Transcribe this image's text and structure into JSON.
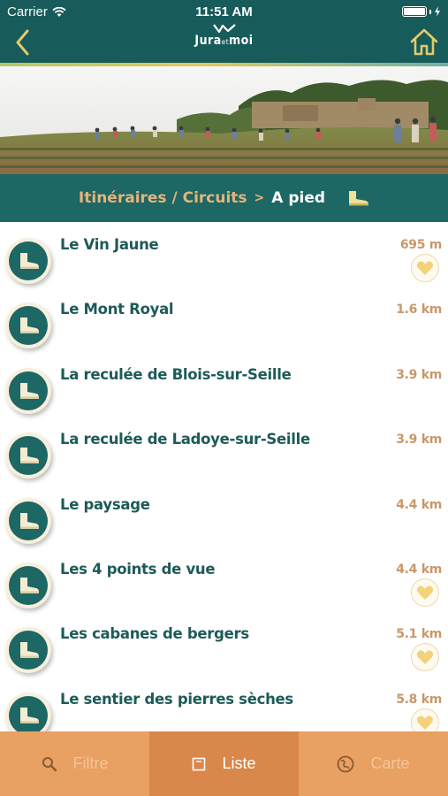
{
  "status": {
    "carrier": "Carrier",
    "time": "11:51 AM"
  },
  "header": {
    "logo_main": "Jura",
    "logo_small": "et",
    "logo_end": "moi"
  },
  "breadcrumb": {
    "parent": "Itinéraires / Circuits",
    "separator": ">",
    "current": "A pied"
  },
  "routes": [
    {
      "title": "Le Vin Jaune",
      "distance": "695 m",
      "favorite": true
    },
    {
      "title": "Le Mont Royal",
      "distance": "1.6 km",
      "favorite": false
    },
    {
      "title": "La reculée de Blois-sur-Seille",
      "distance": "3.9 km",
      "favorite": false
    },
    {
      "title": "La reculée de Ladoye-sur-Seille",
      "distance": "3.9 km",
      "favorite": false
    },
    {
      "title": "Le paysage",
      "distance": "4.4 km",
      "favorite": false
    },
    {
      "title": "Les 4 points de vue",
      "distance": "4.4 km",
      "favorite": true
    },
    {
      "title": "Les cabanes de bergers",
      "distance": "5.1 km",
      "favorite": true
    },
    {
      "title": "Le sentier des pierres sèches",
      "distance": "5.8 km",
      "favorite": true
    }
  ],
  "tabs": {
    "filter": "Filtre",
    "list": "Liste",
    "map": "Carte"
  },
  "colors": {
    "teal": "#175c5a",
    "accent": "#c79869",
    "tab_bg": "#e9a063",
    "tab_active": "#d9874a"
  },
  "icons": {
    "back": "chevron-left-icon",
    "home": "home-icon",
    "walk": "boot-icon",
    "favorite": "heart-icon",
    "search": "search-icon",
    "list": "list-icon",
    "map": "globe-icon"
  }
}
